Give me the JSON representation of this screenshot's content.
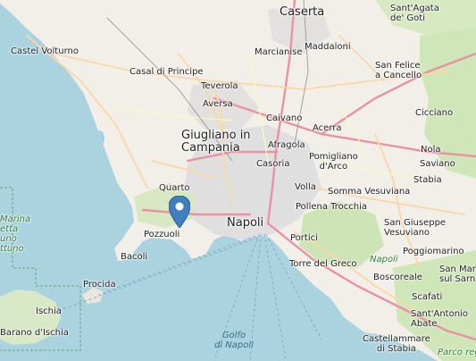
{
  "map": {
    "marker": {
      "label": "location-pin",
      "color": "#3f7fbf"
    },
    "labels": [
      {
        "id": "caserta",
        "text": "Caserta",
        "size": "big"
      },
      {
        "id": "santagata",
        "text": "Sant'Agata de' Goti",
        "size": "small"
      },
      {
        "id": "castel-volturno",
        "text": "Castel Volturno",
        "size": "small"
      },
      {
        "id": "maddaloni",
        "text": "Maddaloni",
        "size": "small"
      },
      {
        "id": "marcianise",
        "text": "Marcianise",
        "size": "small"
      },
      {
        "id": "casal-di-principe",
        "text": "Casal di Principe",
        "size": "small"
      },
      {
        "id": "san-felice",
        "text": "San Felice a Cancello",
        "size": "small"
      },
      {
        "id": "teverola",
        "text": "Teverola",
        "size": "small"
      },
      {
        "id": "aversa",
        "text": "Aversa",
        "size": "small"
      },
      {
        "id": "caivano",
        "text": "Caivano",
        "size": "small"
      },
      {
        "id": "acerra",
        "text": "Acerra",
        "size": "small"
      },
      {
        "id": "cicciano",
        "text": "Cicciano",
        "size": "small"
      },
      {
        "id": "giugliano",
        "text": "Giugliano in Campania",
        "size": "big"
      },
      {
        "id": "afragola",
        "text": "Afragola",
        "size": "small"
      },
      {
        "id": "pomigliano",
        "text": "Pomigliano d'Arco",
        "size": "small"
      },
      {
        "id": "nola",
        "text": "Nola",
        "size": "small"
      },
      {
        "id": "casoria",
        "text": "Casoria",
        "size": "small"
      },
      {
        "id": "saviano",
        "text": "Saviano",
        "size": "small"
      },
      {
        "id": "stabia",
        "text": "Stabia",
        "size": "small"
      },
      {
        "id": "quarto",
        "text": "Quarto",
        "size": "small"
      },
      {
        "id": "volla",
        "text": "Volla",
        "size": "small"
      },
      {
        "id": "somma",
        "text": "Somma Vesuviana",
        "size": "small"
      },
      {
        "id": "pollena",
        "text": "Pollena Trocchia",
        "size": "small"
      },
      {
        "id": "napoli",
        "text": "Napoli",
        "size": "big"
      },
      {
        "id": "pozzuoli",
        "text": "Pozzuoli",
        "size": "small"
      },
      {
        "id": "san-giuseppe",
        "text": "San Giuseppe Vesuviano",
        "size": "small"
      },
      {
        "id": "portici",
        "text": "Portici",
        "size": "small"
      },
      {
        "id": "poggiomarino",
        "text": "Poggiomarino",
        "size": "small"
      },
      {
        "id": "bacoli",
        "text": "Bacoli",
        "size": "small"
      },
      {
        "id": "torre-del-greco",
        "text": "Torre del Greco",
        "size": "small"
      },
      {
        "id": "napoli-park",
        "text": "Napoli",
        "size": "park"
      },
      {
        "id": "san-marzano",
        "text": "San Marz sul Sarn",
        "size": "small"
      },
      {
        "id": "procida",
        "text": "Procida",
        "size": "small"
      },
      {
        "id": "boscoreale",
        "text": "Boscoreale",
        "size": "small"
      },
      {
        "id": "ischia",
        "text": "Ischia",
        "size": "small"
      },
      {
        "id": "scafati",
        "text": "Scafati",
        "size": "small"
      },
      {
        "id": "barano",
        "text": "Barano d'Ischia",
        "size": "small"
      },
      {
        "id": "santantonio",
        "text": "Sant'Antonio Abate",
        "size": "small"
      },
      {
        "id": "marina",
        "text": "Marina etta uno ttuno",
        "size": "green"
      },
      {
        "id": "golfo",
        "text": "Golfo di Napoli",
        "size": "water"
      },
      {
        "id": "castellammare",
        "text": "Castellammare di Stabia",
        "size": "small"
      },
      {
        "id": "parco",
        "text": "Parco regi",
        "size": "park"
      }
    ]
  }
}
